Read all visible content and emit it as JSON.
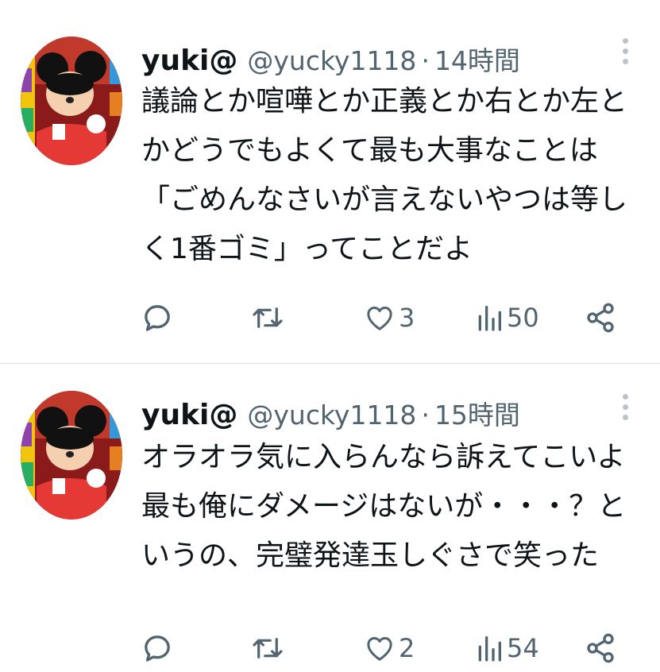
{
  "tweets": [
    {
      "name": "yuki@",
      "handle": "@yucky1118",
      "separator": "·",
      "time": "14時間",
      "text": "議論とか喧嘩とか正義とか右とか左とかどうでもよくて最も大事なことは「ごめんなさいが言えないやつは等しく1番ゴミ」ってことだよ",
      "replies": "",
      "retweets": "",
      "likes": "3",
      "views": "50"
    },
    {
      "name": "yuki@",
      "handle": "@yucky1118",
      "separator": "·",
      "time": "15時間",
      "text": "オラオラ気に入らんなら訴えてこいよ最も俺にダメージはないが・・・？というの、完璧発達玉しぐさで笑った",
      "replies": "",
      "retweets": "",
      "likes": "2",
      "views": "54"
    }
  ],
  "icons": {
    "reply": "reply-icon",
    "retweet": "retweet-icon",
    "like": "heart-icon",
    "views": "views-icon",
    "share": "share-icon",
    "more": "more-vertical-icon",
    "avatar": "avatar-image"
  },
  "colors": {
    "text": "#0f1419",
    "secondary": "#536471",
    "divider": "#d8e2e0",
    "icon": "#536471"
  }
}
